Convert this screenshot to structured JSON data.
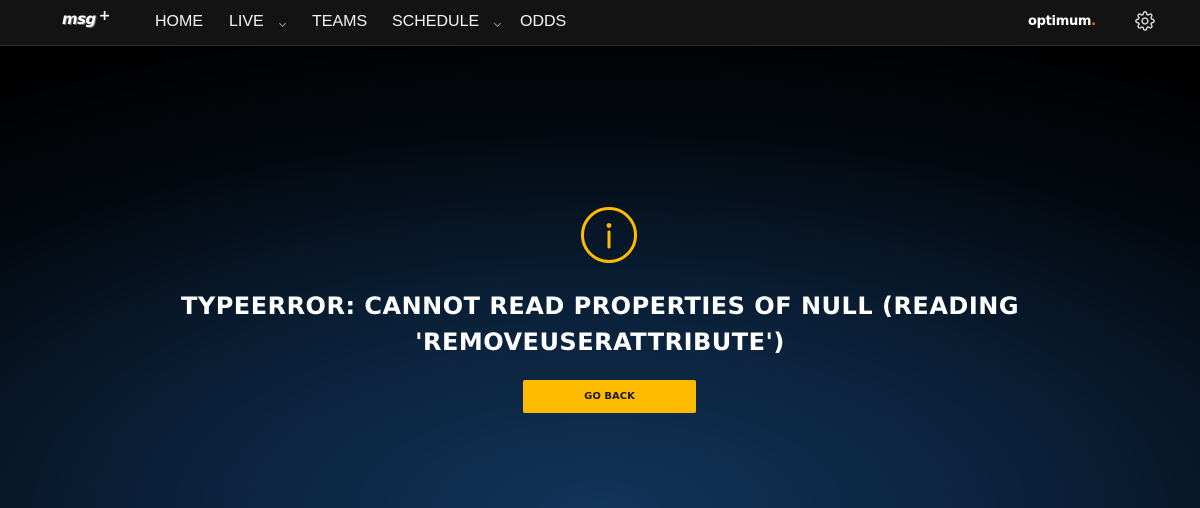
{
  "header": {
    "logo": {
      "text": "msg",
      "plus": "+"
    },
    "nav": {
      "home": "HOME",
      "live": "LIVE",
      "teams": "TEAMS",
      "schedule": "SCHEDULE",
      "odds": "ODDS"
    },
    "brand": {
      "name": "optimum",
      "dot": "."
    },
    "settings_icon": "gear-icon"
  },
  "error": {
    "icon": "info-icon",
    "line1": "TYPEERROR: CANNOT READ PROPERTIES OF NULL (READING",
    "line2": "'REMOVEUSERATTRIBUTE')",
    "button_label": "GO BACK"
  },
  "colors": {
    "accent": "#ffbb00",
    "header_bg": "#131313",
    "brand_dot": "#f36b21"
  }
}
